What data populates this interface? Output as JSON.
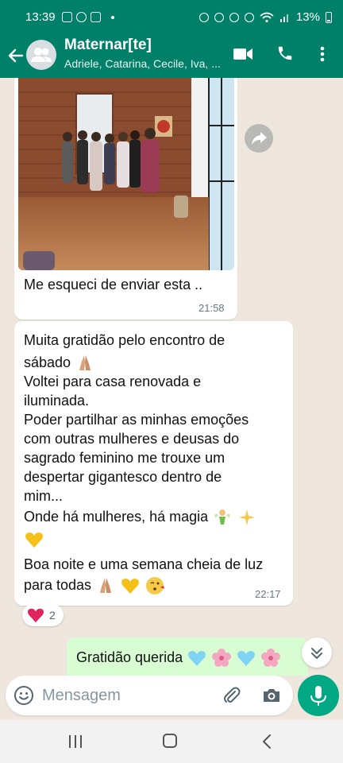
{
  "status_bar": {
    "time": "13:39",
    "battery": "13%"
  },
  "header": {
    "title": "Maternar[te]",
    "subtitle": "Adriele, Catarina, Cecile, Iva, ...",
    "back_icon": "back-arrow-icon",
    "video_icon": "video-call-icon",
    "call_icon": "phone-icon",
    "menu_icon": "more-vertical-icon"
  },
  "messages": [
    {
      "type": "image",
      "caption": "Me esqueci de enviar esta ..",
      "time": "21:58"
    },
    {
      "type": "text",
      "lines": [
        "Muita gratidão pelo encontro de",
        "sábado",
        "Voltei para casa renovada e",
        "iluminada.",
        "Poder partilhar as minhas emoções",
        "com outras mulheres e deusas do",
        "sagrado feminino me trouxe um",
        "despertar gigantesco dentro de",
        "mim...",
        "Onde há mulheres, há magia",
        "",
        "Boa noite e uma semana cheia de luz",
        "para todas"
      ],
      "time": "22:17",
      "reaction": {
        "emoji": "red-heart",
        "count": "2"
      }
    },
    {
      "type": "outgoing",
      "text": "Gratidão querida"
    }
  ],
  "composer": {
    "placeholder": "Mensagem"
  },
  "colors": {
    "header": "#008069",
    "chat_bg": "#efe7de",
    "outgoing": "#d9fdd3",
    "accent": "#00a884"
  }
}
